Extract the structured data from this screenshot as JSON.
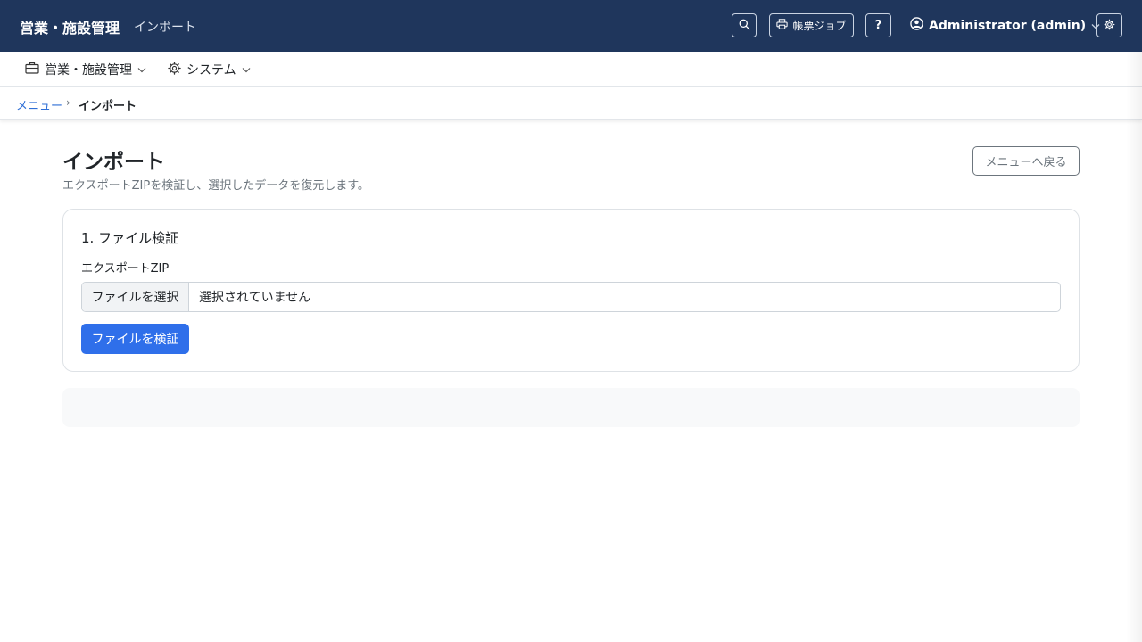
{
  "header": {
    "brand": "営業・施設管理",
    "page_label": "インポート",
    "print_jobs_label": "帳票ジョブ",
    "help_label": "?",
    "user_label": "Administrator (admin)",
    "icons": [
      "search-icon",
      "printer-icon",
      "user-circle-icon",
      "chevron-down-icon",
      "gear-icon"
    ],
    "background_color": "#1f365c"
  },
  "menubar": {
    "items": [
      {
        "label": "営業・施設管理",
        "icon": "briefcase-icon"
      },
      {
        "label": "システム",
        "icon": "gear-icon"
      }
    ]
  },
  "breadcrumb": {
    "items": [
      {
        "label": "メニュー"
      },
      {
        "label": "インポート"
      }
    ],
    "separator": "›"
  },
  "main": {
    "title": "インポート",
    "subtitle": "エクスポートZIPを検証し、選択したデータを復元します。",
    "back_button_label": "メニューへ戻る",
    "card": {
      "title": "1. ファイル検証",
      "field_label": "エクスポートZIP",
      "file_button_label": "ファイルを選択",
      "file_status": "選択されていません",
      "verify_button_label": "ファイルを検証"
    },
    "accent_color": "#2f6fea"
  }
}
